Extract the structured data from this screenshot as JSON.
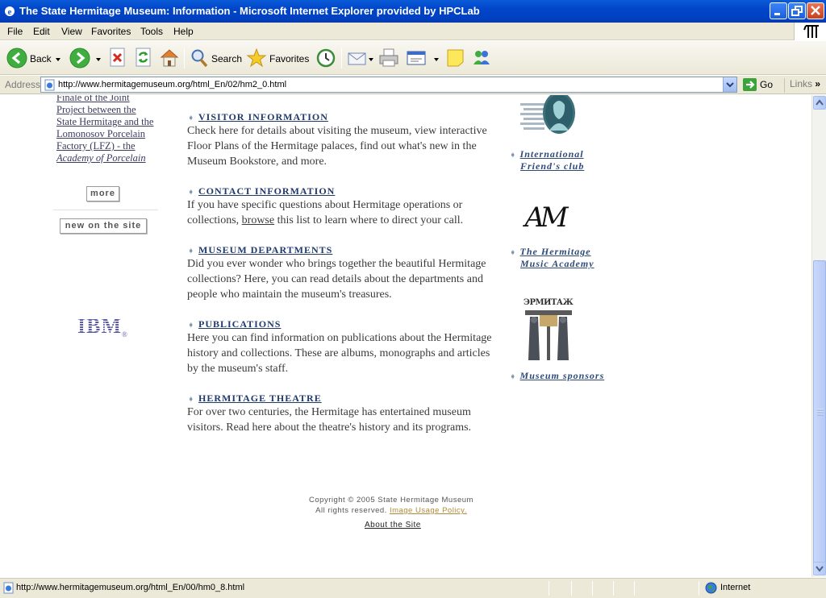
{
  "window": {
    "title": "The State Hermitage Museum: Information - Microsoft Internet Explorer provided by HPCLab"
  },
  "menu": [
    "File",
    "Edit",
    "View",
    "Favorites",
    "Tools",
    "Help"
  ],
  "toolbar": {
    "back_label": "Back",
    "search_label": "Search",
    "favorites_label": "Favorites"
  },
  "address": {
    "label": "Address",
    "url": "http://www.hermitagemuseum.org/html_En/02/hm2_0.html",
    "go_label": "Go",
    "links_label": "Links"
  },
  "left_column": {
    "news_lines": [
      "Finale of the Joint",
      "Project between the",
      "State Hermitage and the",
      "Lomonosov Porcelain",
      "Factory (LFZ) - the"
    ],
    "news_italic_line": "Academy of Porcelain",
    "more_label": "more",
    "new_on_site_label": "new on the site",
    "ibm_logo": "IBM"
  },
  "sections": [
    {
      "heading": "VISITOR INFORMATION",
      "text": "Check here for details about visiting the museum, view interactive Floor Plans of the Hermitage palaces, find out what's new in the Museum Bookstore, and more."
    },
    {
      "heading": "CONTACT INFORMATION",
      "text_before": "If you have specific questions about Hermitage operations or collections, ",
      "link": "browse",
      "text_after": " this list to learn where to direct your call."
    },
    {
      "heading": "MUSEUM DEPARTMENTS",
      "text": "Did you ever wonder who brings together the beautiful Hermitage collections? Here, you can read details about the departments and people who maintain the museum's treasures."
    },
    {
      "heading": "PUBLICATIONS",
      "text": "Here you can find information on publications about the Hermitage history and collections. These are albums, monographs and articles by the museum's staff."
    },
    {
      "heading": "HERMITAGE THEATRE",
      "text": "For over two centuries, the Hermitage has entertained museum visitors. Read here about the theatre's history and its programs."
    }
  ],
  "right_column": {
    "friends_line1": "International",
    "friends_line2": "Friend's club",
    "music_logo_text": "АМ",
    "music_line1": "The Hermitage",
    "music_line2": "Music Academy",
    "sponsors_logo_text": "ЭРМИТАЖ",
    "sponsors_label": "Museum sponsors"
  },
  "footer": {
    "copyright": "Copyright © 2005 State Hermitage Museum",
    "rights": "All rights reserved.",
    "policy_link": "Image Usage Policy.",
    "about_link": "About the Site"
  },
  "statusbar": {
    "url": "http://www.hermitagemuseum.org/html_En/00/hm0_8.html",
    "zone": "Internet"
  }
}
